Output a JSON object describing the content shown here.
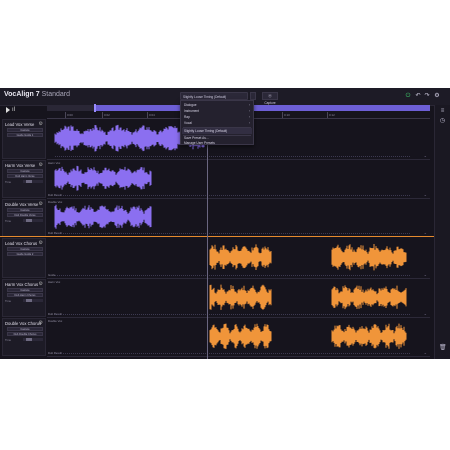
{
  "app": {
    "name": "VocAlign 7",
    "edition": "Standard"
  },
  "header": {
    "preset_value": "Slightly Loose Timing (Default)",
    "capture_label": "⦿ Capture",
    "icons": [
      "power-icon",
      "undo-icon",
      "redo-icon",
      "settings-icon"
    ]
  },
  "preset_menu": {
    "items": [
      {
        "label": "Dialogue",
        "submenu": true
      },
      {
        "label": "Instrument",
        "submenu": true
      },
      {
        "label": "Rap",
        "submenu": true
      },
      {
        "label": "Vocal",
        "submenu": true
      },
      {
        "label": "Slightly Loose Timing (Default)",
        "submenu": false
      },
      {
        "label": "Save Preset As…",
        "submenu": false
      },
      {
        "label": "Manage User Presets",
        "submenu": false
      }
    ]
  },
  "ruler": {
    "ticks": [
      "0:00",
      "0:02",
      "0:04",
      "0:06",
      "0:08",
      "0:10",
      "0:12"
    ]
  },
  "tracks": [
    {
      "name": "Lead Vox Verse",
      "role": "guide",
      "mode": "Capture",
      "sub": "Guide Guide 1",
      "lane_top": "",
      "lane_bottom": ""
    },
    {
      "name": "Harm Vox Verse",
      "role": "dub",
      "mode": "Capture",
      "sub": "Dub Harm Verse",
      "time_label": "Time",
      "lane_top": "Harm Vox",
      "lane_bottom": "Dub Result"
    },
    {
      "name": "Double Vox Verse",
      "role": "dub",
      "mode": "Capture",
      "sub": "Dub Double Verse",
      "time_label": "Time",
      "lane_top": "Double Vox",
      "lane_bottom": "Dub Result"
    },
    {
      "name": "Lead Vox Chorus",
      "role": "guide",
      "mode": "Capture",
      "sub": "Guide Guide 2",
      "lane_top": "",
      "lane_bottom": "Guide"
    },
    {
      "name": "Harm Vox Chorus",
      "role": "dub",
      "mode": "Capture",
      "sub": "Dub Harm Chorus",
      "time_label": "Time",
      "lane_top": "Harm Vox",
      "lane_bottom": "Dub Result"
    },
    {
      "name": "Double Vox Chorus",
      "role": "dub",
      "mode": "Capture",
      "sub": "Dub Double Chorus",
      "time_label": "Time",
      "lane_top": "Double Vox",
      "lane_bottom": "Dub Result"
    }
  ],
  "colors": {
    "verse": "#8b6ff0",
    "chorus": "#f0953a",
    "background": "#16141d",
    "divider": "#e58a2e"
  }
}
